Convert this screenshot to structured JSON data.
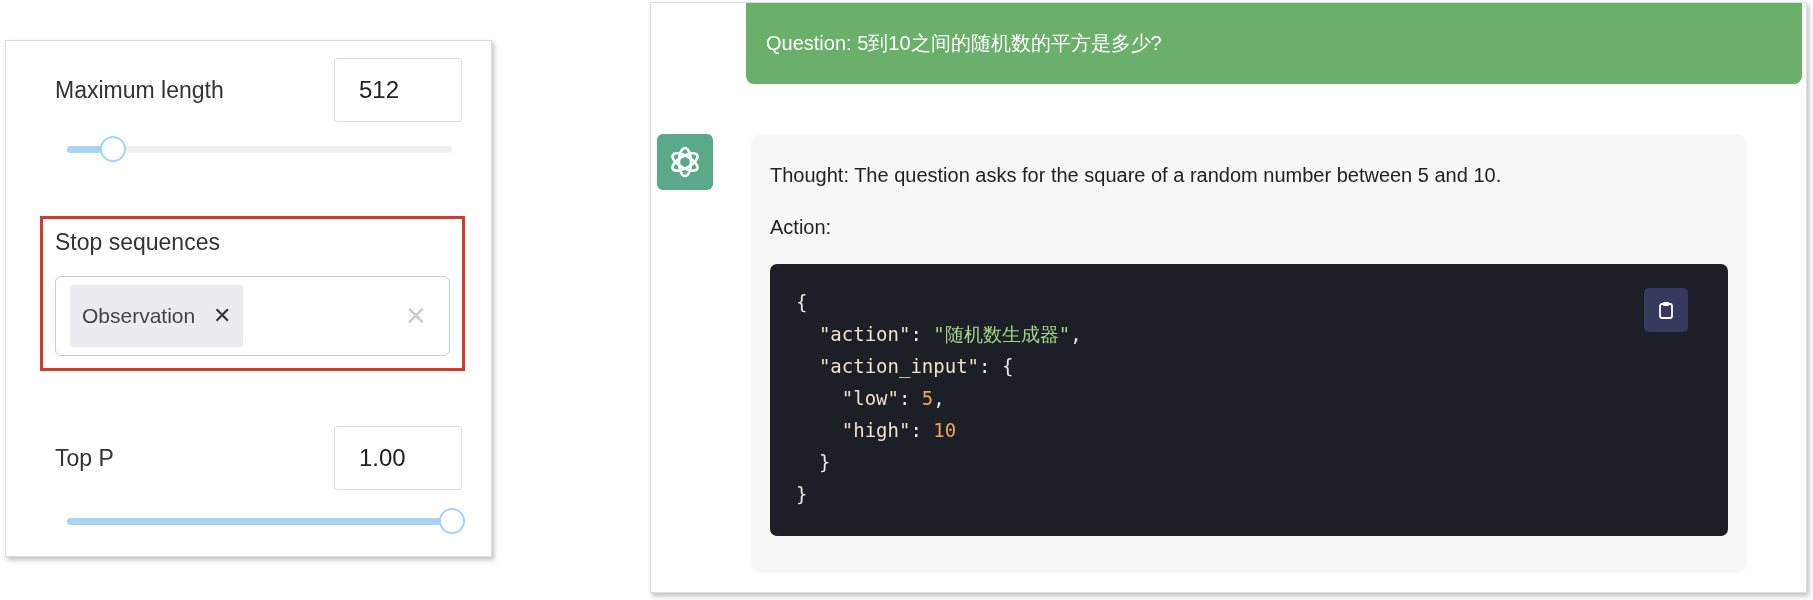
{
  "settings_panel": {
    "fields": [
      {
        "kind": "slider",
        "label": "Maximum length",
        "value": "512",
        "level": 0.12,
        "highlighted": false
      },
      {
        "kind": "tags",
        "label": "Stop sequences",
        "tags": [
          {
            "label": "Observation",
            "remove": "✕"
          }
        ],
        "clear": "✕",
        "highlighted": true
      },
      {
        "kind": "slider",
        "label": "Top P",
        "value": "1.00",
        "level": 1.0,
        "highlighted": false
      }
    ]
  },
  "chat": {
    "question": "Question: 5到10之间的随机数的平方是多少?",
    "answer": {
      "thought": "Thought: The question asks for the square of a random number between 5 and 10.",
      "action_label": "Action:",
      "code": [
        [
          {
            "kind": "punct",
            "text": "{"
          }
        ],
        [
          {
            "kind": "key",
            "text": "  \"action\""
          },
          {
            "kind": "punct",
            "text": ": "
          },
          {
            "kind": "string",
            "text": "\"随机数生成器\""
          },
          {
            "kind": "punct",
            "text": ","
          }
        ],
        [
          {
            "kind": "key",
            "text": "  \"action_input\""
          },
          {
            "kind": "punct",
            "text": ": {"
          }
        ],
        [
          {
            "kind": "key",
            "text": "    \"low\""
          },
          {
            "kind": "punct",
            "text": ": "
          },
          {
            "kind": "number",
            "text": "5"
          },
          {
            "kind": "punct",
            "text": ","
          }
        ],
        [
          {
            "kind": "key",
            "text": "    \"high\""
          },
          {
            "kind": "punct",
            "text": ": "
          },
          {
            "kind": "number",
            "text": "10"
          }
        ],
        [
          {
            "kind": "punct",
            "text": "  }"
          }
        ],
        [
          {
            "kind": "punct",
            "text": "}"
          }
        ]
      ]
    }
  }
}
